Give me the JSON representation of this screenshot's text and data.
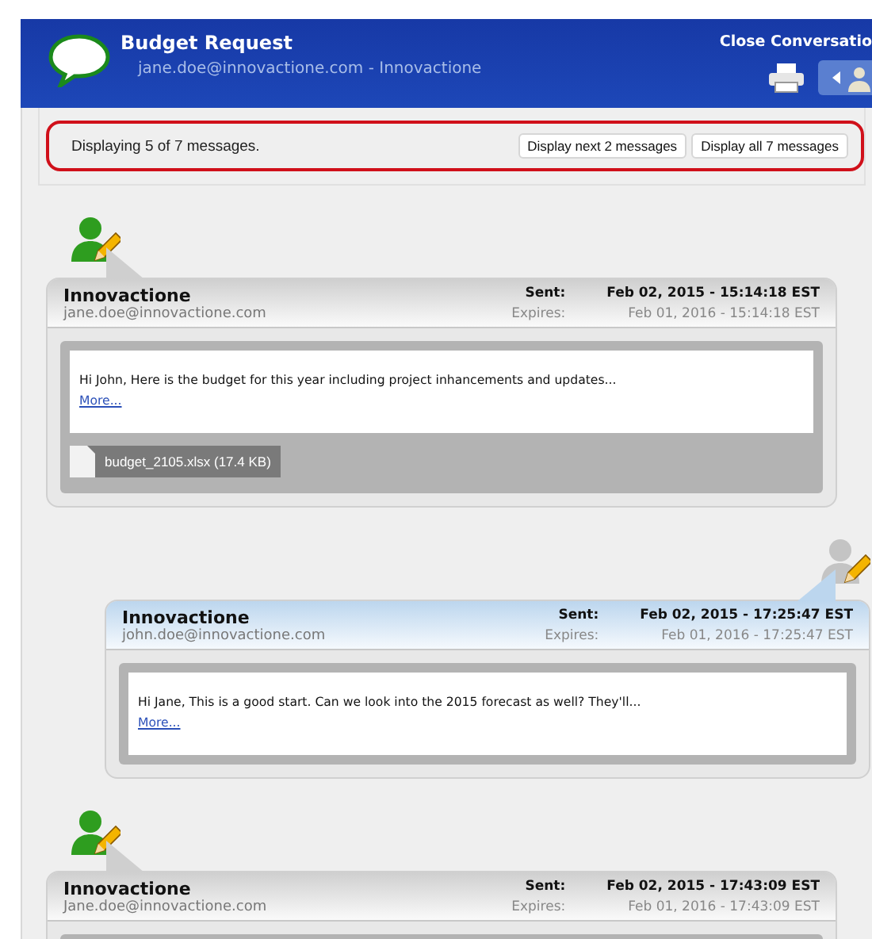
{
  "header": {
    "title": "Budget Request",
    "subtitle": "jane.doe@innovactione.com - Innovactione",
    "close_label": "Close Conversatio"
  },
  "notice": {
    "text": "Displaying 5 of 7 messages.",
    "buttons": [
      "Display next 2 messages",
      "Display all 7 messages"
    ]
  },
  "messages": [
    {
      "kind": "incoming",
      "sender": "Innovactione",
      "email": "jane.doe@innovactione.com",
      "sent_label": "Sent:",
      "sent": "Feb 02, 2015 - 15:14:18 EST",
      "expires_label": "Expires:",
      "expires": "Feb 01, 2016 - 15:14:18 EST",
      "body": "Hi John,  Here is the budget for this year including project inhancements and updates...",
      "more": "More...",
      "attachment": "budget_2105.xlsx (17.4 KB)"
    },
    {
      "kind": "outgoing",
      "sender": "Innovactione",
      "email": "john.doe@innovactione.com",
      "sent_label": "Sent:",
      "sent": "Feb 02, 2015 - 17:25:47 EST",
      "expires_label": "Expires:",
      "expires": "Feb 01, 2016 - 17:25:47 EST",
      "body": "Hi Jane,  This is a good start.  Can we look into the 2015 forecast as well?  They'll...",
      "more": "More..."
    },
    {
      "kind": "incoming",
      "sender": "Innovactione",
      "email": "Jane.doe@innovactione.com",
      "sent_label": "Sent:",
      "sent": "Feb 02, 2015 - 17:43:09 EST",
      "expires_label": "Expires:",
      "expires": "Feb 01, 2016 - 17:43:09 EST"
    }
  ]
}
